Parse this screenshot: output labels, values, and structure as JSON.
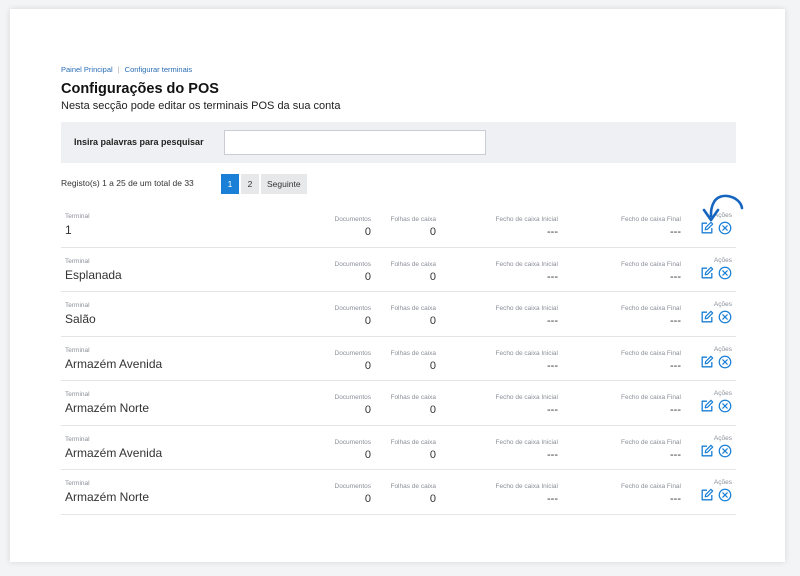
{
  "breadcrumb": {
    "home": "Painel Principal",
    "current": "Configurar terminais"
  },
  "page": {
    "title": "Configurações do POS",
    "subtitle": "Nesta secção pode editar os terminais POS da sua conta"
  },
  "search": {
    "label": "Insira palavras para pesquisar",
    "value": "",
    "placeholder": ""
  },
  "records": {
    "info": "Registo(s) 1 a 25 de um total de 33"
  },
  "pagination": {
    "page1": "1",
    "page2": "2",
    "next": "Seguinte"
  },
  "columns": {
    "terminal": "Terminal",
    "documentos": "Documentos",
    "folhas": "Folhas de caixa",
    "fecho_inicial": "Fecho de caixa Inicial",
    "fecho_final": "Fecho de caixa Final",
    "acoes": "Ações"
  },
  "rows": [
    {
      "terminal": "1",
      "documentos": "0",
      "folhas": "0",
      "fecho_inicial": "---",
      "fecho_final": "---"
    },
    {
      "terminal": "Esplanada",
      "documentos": "0",
      "folhas": "0",
      "fecho_inicial": "---",
      "fecho_final": "---"
    },
    {
      "terminal": "Salão",
      "documentos": "0",
      "folhas": "0",
      "fecho_inicial": "---",
      "fecho_final": "---"
    },
    {
      "terminal": "Armazém Avenida",
      "documentos": "0",
      "folhas": "0",
      "fecho_inicial": "---",
      "fecho_final": "---"
    },
    {
      "terminal": "Armazém Norte",
      "documentos": "0",
      "folhas": "0",
      "fecho_inicial": "---",
      "fecho_final": "---"
    },
    {
      "terminal": "Armazém Avenida",
      "documentos": "0",
      "folhas": "0",
      "fecho_inicial": "---",
      "fecho_final": "---"
    },
    {
      "terminal": "Armazém Norte",
      "documentos": "0",
      "folhas": "0",
      "fecho_inicial": "---",
      "fecho_final": "---"
    }
  ],
  "icons": {
    "edit": "edit-icon",
    "delete": "delete-circle-x-icon",
    "annotation": "curved-arrow-icon"
  },
  "colors": {
    "accent": "#1a7fd6",
    "link": "#2a6db5",
    "annotation": "#1565c0"
  }
}
